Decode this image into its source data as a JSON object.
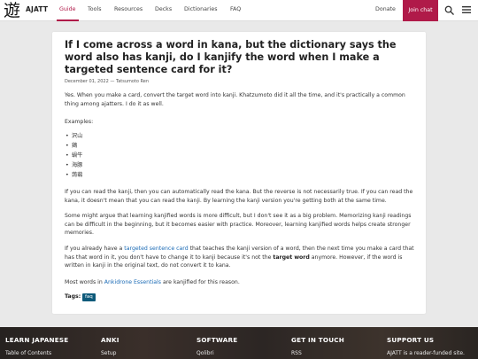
{
  "nav": {
    "logo_glyph": "遊",
    "brand": "AJATT",
    "items": [
      {
        "label": "Guide"
      },
      {
        "label": "Tools"
      },
      {
        "label": "Resources"
      },
      {
        "label": "Decks"
      },
      {
        "label": "Dictionaries"
      },
      {
        "label": "FAQ"
      }
    ],
    "active": "Guide",
    "donate": "Donate",
    "join": "Join chat",
    "accent": "#b01a49",
    "search_icon": "search-icon",
    "menu_icon": "hamburger-menu-icon"
  },
  "article": {
    "title": "If I come across a word in kana, but the dictionary says the word also has kanji, do I kanjify the word when I make a targeted sentence card for it?",
    "date": "December 01, 2022",
    "separator": "—",
    "author": "Tatsumoto Ren",
    "p1": "Yes. When you make a card, convert the target word into kanji. Khatzumoto did it all the time, and it's practically a common thing among ajatters. I do it as well.",
    "examples_label": "Examples:",
    "examples": [
      "沢山",
      "鶏",
      "蝸牛",
      "海豚",
      "蒟蒻"
    ],
    "p2": "If you can read the kanji, then you can automatically read the kana. But the reverse is not necessarily true. If you can read the kana, it doesn't mean that you can read the kanji. By learning the kanji version you're getting both at the same time.",
    "p3": "Some might argue that learning kanjified words is more difficult, but I don't see it as a big problem. Memorizing kanji readings can be difficult in the beginning, but it becomes easier with practice. Moreover, learning kanjified words helps create stronger memories.",
    "p4_a": "If you already have a ",
    "p4_link": "targeted sentence card",
    "p4_b": " that teaches the kanji version of a word, then the next time you make a card that has that word in it, you don't have to change it to kanji because it's not the ",
    "p4_bold": "target word",
    "p4_c": " anymore. However, if the word is written in kanji in the original text, do not convert it to kana.",
    "p5_a": "Most words in ",
    "p5_link": "Ankidrone Essentials",
    "p5_b": " are kanjified for this reason.",
    "tags_label": "Tags:",
    "tag": "faq",
    "link_color": "#1a6ab5",
    "tag_color": "#0e5a7a"
  },
  "footer": {
    "columns": [
      {
        "heading": "LEARN JAPANESE",
        "link": "Table of Contents"
      },
      {
        "heading": "ANKI",
        "link": "Setup"
      },
      {
        "heading": "SOFTWARE",
        "link": "Qolibri"
      },
      {
        "heading": "GET IN TOUCH",
        "link": "RSS"
      },
      {
        "heading": "SUPPORT US",
        "link": "AJATT is a reader-funded site."
      }
    ]
  }
}
